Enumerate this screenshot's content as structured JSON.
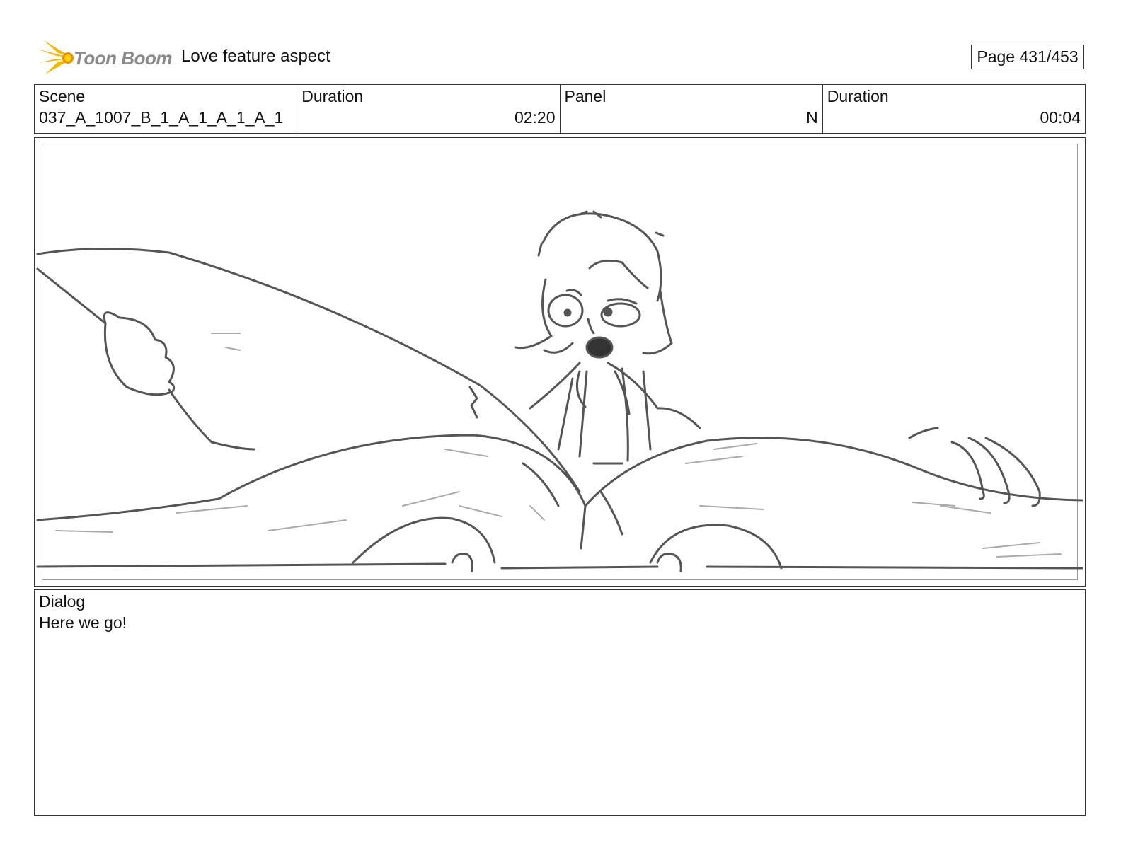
{
  "header": {
    "logo_text": "Toon Boom",
    "project_title": "Love feature aspect",
    "page_label": "Page 431/453"
  },
  "info": {
    "scene_label": "Scene",
    "scene_value": "037_A_1007_B_1_A_1_A_1_A_1",
    "scene_duration_label": "Duration",
    "scene_duration_value": "02:20",
    "panel_label": "Panel",
    "panel_value": "N",
    "panel_duration_label": "Duration",
    "panel_duration_value": "00:04"
  },
  "dialog": {
    "label": "Dialog",
    "text": "Here we go!"
  },
  "colors": {
    "logo_yellow": "#f5b800",
    "logo_orange": "#f08c00",
    "sketch_line": "#555555"
  }
}
